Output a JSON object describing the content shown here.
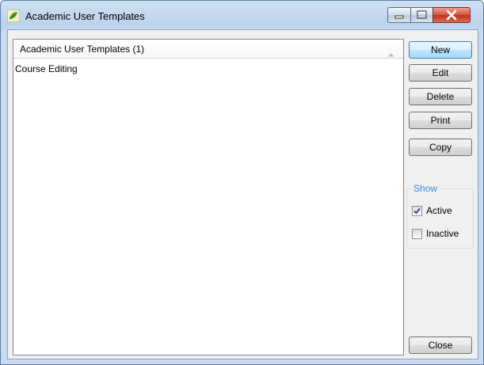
{
  "window": {
    "title": "Academic User Templates",
    "icon": "app-leaf-icon",
    "controls": [
      "minimize-icon",
      "maximize-icon",
      "close-icon"
    ]
  },
  "list": {
    "header": "Academic User Templates (1)",
    "rows": [
      "Course Editing"
    ]
  },
  "buttons": {
    "new": "New",
    "edit": "Edit",
    "delete": "Delete",
    "print": "Print",
    "copy": "Copy",
    "close": "Close"
  },
  "show_group": {
    "label": "Show",
    "active": {
      "label": "Active",
      "checked": true
    },
    "inactive": {
      "label": "Inactive",
      "checked": false
    }
  },
  "colors": {
    "group_label": "#3c8fe0",
    "close_button": "#c0311c",
    "default_button_border": "#3c7fb1"
  }
}
